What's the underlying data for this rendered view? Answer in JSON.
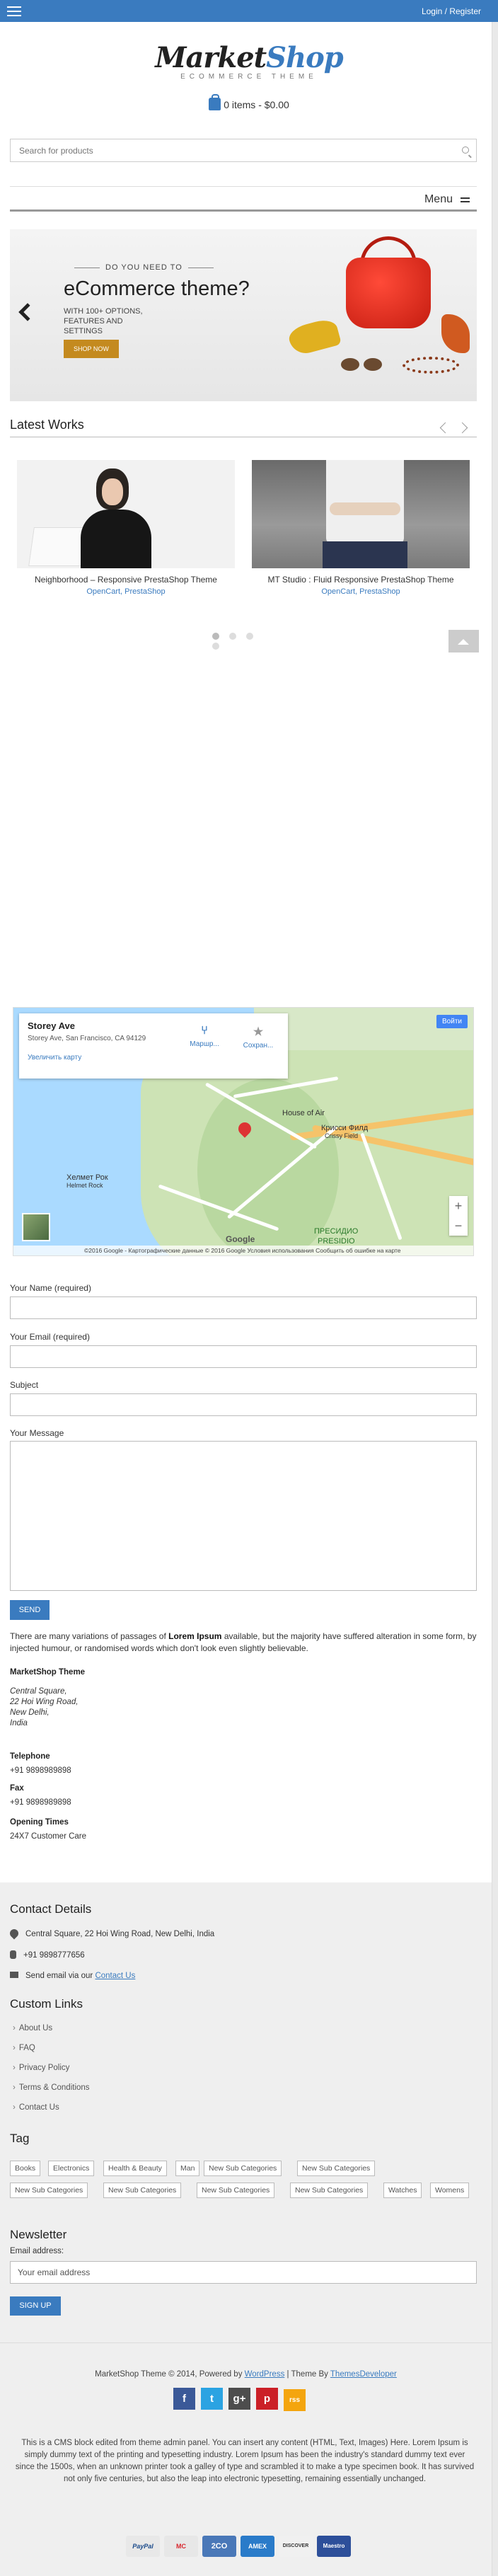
{
  "topbar": {
    "login_label": "Login / Register"
  },
  "logo": {
    "main_a": "Market",
    "main_b": "Shop",
    "sub": "ECOMMERCE THEME"
  },
  "cart": {
    "label": "0 items - $0.00"
  },
  "search": {
    "placeholder": "Search for products"
  },
  "menu": {
    "label": "Menu"
  },
  "banner": {
    "pretitle": "DO YOU NEED TO",
    "title": "eCommerce theme?",
    "desc": "WITH 100+ OPTIONS, FEATURES AND SETTINGS",
    "button": "SHOP NOW"
  },
  "latest": {
    "title": "Latest Works",
    "items": [
      {
        "caption": "Neighborhood – Responsive PrestaShop Theme",
        "tags": "OpenCart, PrestaShop"
      },
      {
        "caption": "MT Studio : Fluid Responsive PrestaShop Theme",
        "tags": "OpenCart, PrestaShop"
      }
    ]
  },
  "map": {
    "place": "Storey Ave",
    "address": "Storey Ave, San Francisco, CA 94129",
    "enlarge": "Увеличить карту",
    "directions": "Маршр...",
    "save": "Сохран...",
    "signin": "Войти",
    "labels": [
      "House of Air",
      "Крисси Филд",
      "Crissy Field",
      "Хелмет Рок",
      "Helmet Rock",
      "ПРЕСИДИО",
      "PRESIDIO"
    ],
    "footer": "©2016 Google - Картографические данные © 2016 Google    Условия использования    Сообщить об ошибке на карте",
    "google": "Google"
  },
  "form": {
    "name_label": "Your Name (required)",
    "email_label": "Your Email (required)",
    "subject_label": "Subject",
    "message_label": "Your Message",
    "send": "SEND"
  },
  "about": {
    "pre": "There are many variations of passages of ",
    "bold": "Lorem Ipsum",
    "post": " available, but the majority have suffered alteration in some form, by injected humour, or randomised words which don't look even slightly believable."
  },
  "store": {
    "name": "MarketShop Theme",
    "address_lines": [
      "Central Square,",
      "22 Hoi Wing Road,",
      "New Delhi,",
      "India"
    ],
    "tel_label": "Telephone",
    "tel": "+91 9898989898",
    "fax_label": "Fax",
    "fax": "+91 9898989898",
    "hours_label": "Opening Times",
    "hours": "24X7 Customer Care"
  },
  "footer": {
    "contact_title": "Contact Details",
    "contact_address": "Central Square, 22 Hoi Wing Road, New Delhi, India",
    "contact_phone": "+91 9898777656",
    "contact_email_pre": "Send email via our ",
    "contact_email_link": "Contact Us",
    "links_title": "Custom Links",
    "links": [
      "About Us",
      "FAQ",
      "Privacy Policy",
      "Terms & Conditions",
      "Contact Us"
    ],
    "tag_title": "Tag",
    "tags": [
      "Books",
      "Electronics",
      "Health & Beauty",
      "Man",
      "New Sub Categories",
      "New Sub Categories",
      "New Sub Categories",
      "New Sub Categories",
      "New Sub Categories",
      "New Sub Categories",
      "Watches",
      "Womens"
    ],
    "newsletter_title": "Newsletter",
    "newsletter_label": "Email address:",
    "newsletter_placeholder": "Your email address",
    "signup": "SIGN UP",
    "copy_pre": "MarketShop Theme © 2014, Powered by ",
    "copy_wp": "WordPress",
    "copy_mid": " | Theme By ",
    "copy_dev": "ThemesDeveloper",
    "social": [
      {
        "icon": "f",
        "name": "facebook-icon",
        "color": "#3b5998"
      },
      {
        "icon": "t",
        "name": "twitter-icon",
        "color": "#2ba3e2"
      },
      {
        "icon": "g+",
        "name": "googleplus-icon",
        "color": "#4d4d4d"
      },
      {
        "icon": "p",
        "name": "pinterest-icon",
        "color": "#cb2027"
      },
      {
        "icon": "rss",
        "name": "rss-icon",
        "color": "#f4a50e"
      }
    ],
    "cms": "This is a CMS block edited from theme admin panel. You can insert any content (HTML, Text, Images) Here. Lorem Ipsum is simply dummy text of the printing and typesetting industry. Lorem Ipsum has been the industry's standard dummy text ever since the 1500s, when an unknown printer took a galley of type and scrambled it to make a type specimen book. It has survived not only five centuries, but also the leap into electronic typesetting, remaining essentially unchanged.",
    "payments": [
      {
        "label": "PayPal",
        "color": "#e8e8e8",
        "text": "#1a4a8a"
      },
      {
        "label": "MC",
        "color": "#e7e7e7",
        "text": "#d8272e"
      },
      {
        "label": "2CO",
        "color": "#4a78b8",
        "text": "#ffffff"
      },
      {
        "label": "AMEX",
        "color": "#2a7bc9",
        "text": "#ffffff"
      },
      {
        "label": "DISCOVER",
        "color": "#f0f0f0",
        "text": "#333333"
      },
      {
        "label": "Maestro",
        "color": "#2d4f9a",
        "text": "#ffffff"
      }
    ]
  },
  "colors": {
    "accent": "#3a7bbf",
    "footer_bg": "#efefef"
  }
}
